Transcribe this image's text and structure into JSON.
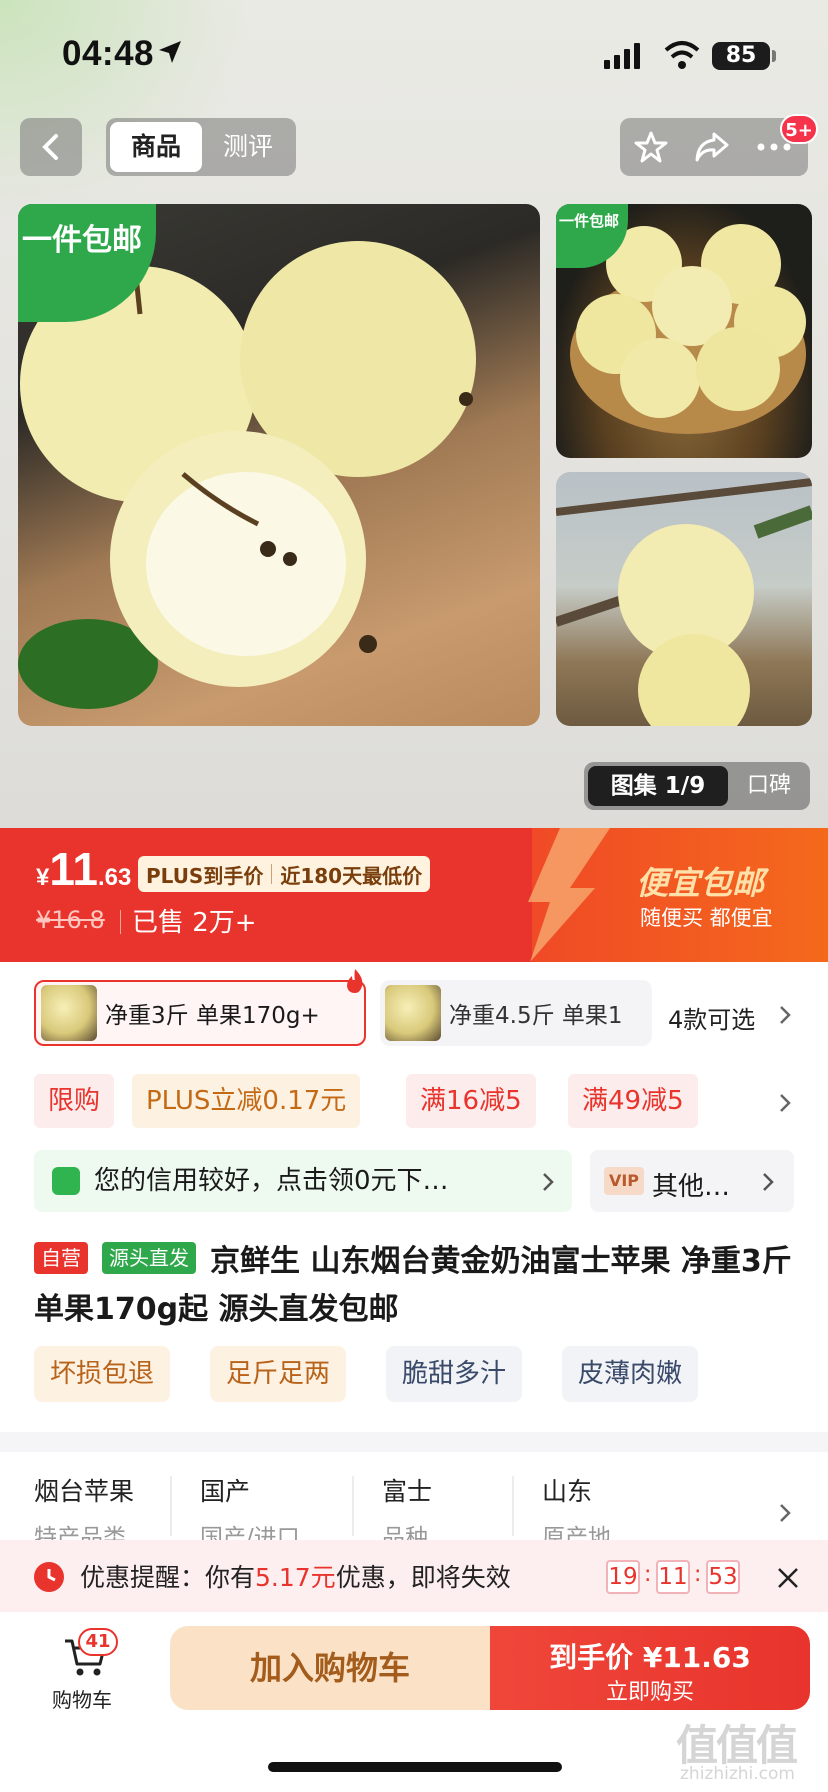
{
  "status": {
    "time": "04:48",
    "battery": "85"
  },
  "nav": {
    "tab_product": "商品",
    "tab_review": "测评",
    "badge": "5+"
  },
  "gallery": {
    "tag_main": "一件包邮",
    "tag_small": "一件包邮",
    "album_label": "图集 1/9",
    "reviews_tab": "口碑"
  },
  "price": {
    "currency": "¥",
    "integer": "11",
    "decimal": ".63",
    "plus_label": "PLUS到手价",
    "lowest_label": "近180天最低价",
    "old_price": "¥16.8",
    "sold": "已售 2万+",
    "promo_title": "便宜包邮",
    "promo_sub": "随便买 都便宜"
  },
  "variants": {
    "items": [
      {
        "label": "净重3斤 单果170g+"
      },
      {
        "label": "净重4.5斤 单果1"
      }
    ],
    "more": "4款可选"
  },
  "chips": [
    "限购",
    "PLUS立减0.17元",
    "满16减5",
    "满49减5"
  ],
  "credit": {
    "text": "您的信用较好，点击领0元下…",
    "vip_badge": "VIP",
    "vip_text": "其他…"
  },
  "product": {
    "tag_self": "自营",
    "tag_source": "源头直发",
    "title": "京鲜生 山东烟台黄金奶油富士苹果 净重3斤 单果170g起 源头直发包邮"
  },
  "features": [
    "坏损包退",
    "足斤足两",
    "脆甜多汁",
    "皮薄肉嫩"
  ],
  "specs": [
    {
      "value": "烟台苹果",
      "label": "特产品类"
    },
    {
      "value": "国产",
      "label": "国产/进口"
    },
    {
      "value": "富士",
      "label": "品种"
    },
    {
      "value": "山东",
      "label": "原产地"
    }
  ],
  "alert": {
    "prefix": "优惠提醒：你有",
    "amount": "5.17元",
    "suffix": "优惠，即将失效",
    "countdown": [
      "19",
      "11",
      "53"
    ]
  },
  "bottom": {
    "cart_label": "购物车",
    "cart_count": "41",
    "add_cart": "加入购物车",
    "buy_label": "到手价 ¥11.63",
    "buy_sub": "立即购买"
  },
  "watermark": {
    "main": "值值值",
    "sub": "zhizhizhi.com"
  },
  "colors": {
    "accent": "#e8342c",
    "green": "#2fa84b",
    "promo": "#f4691c"
  }
}
